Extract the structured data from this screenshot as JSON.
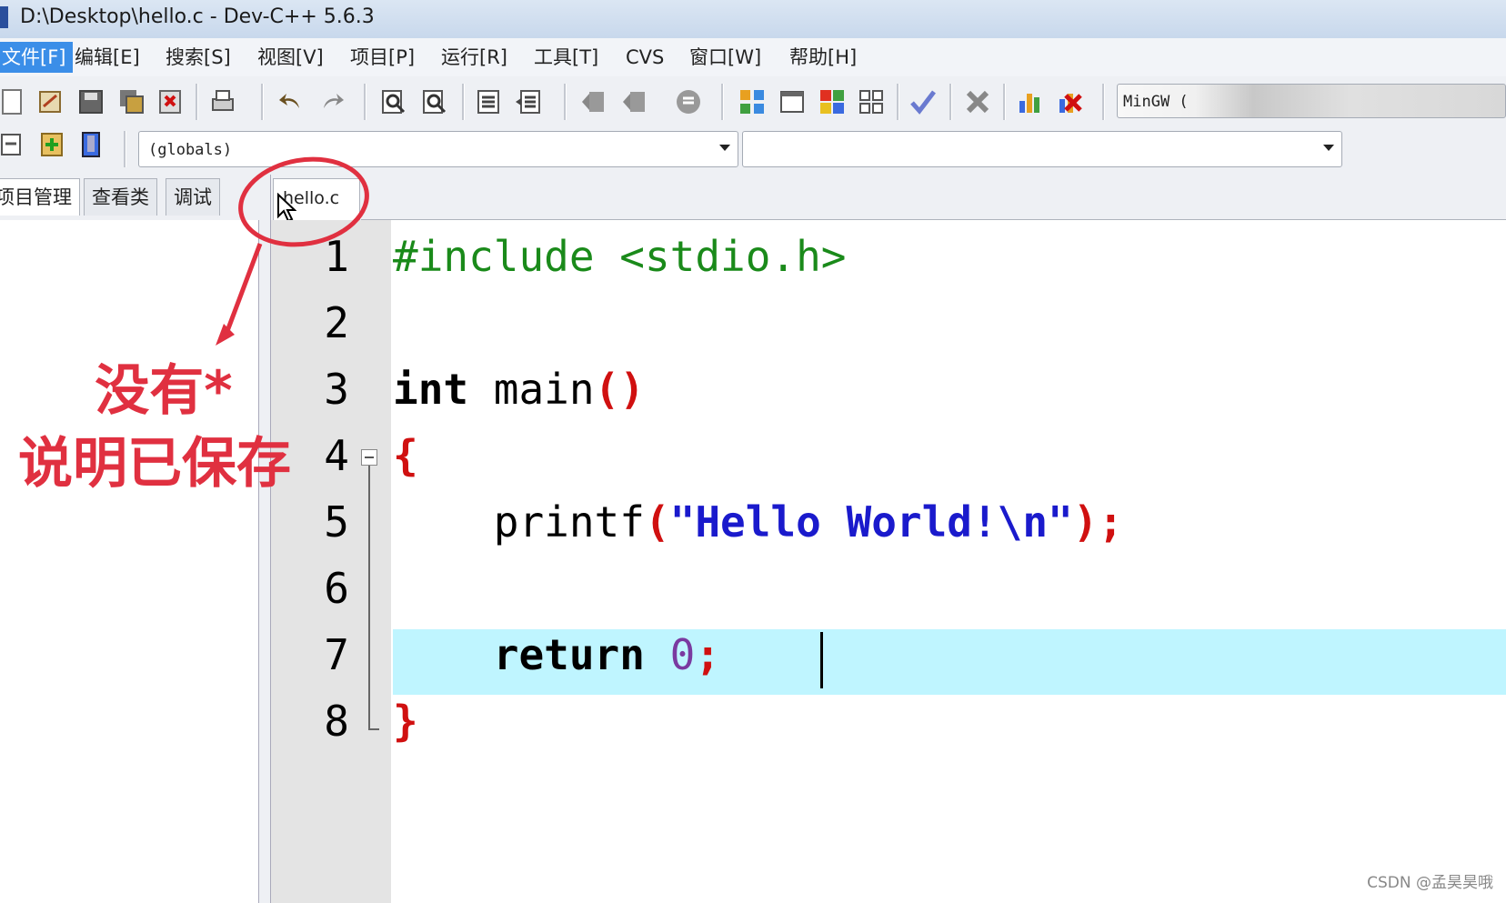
{
  "window": {
    "title": "D:\\Desktop\\hello.c - Dev-C++ 5.6.3"
  },
  "menu": {
    "items": [
      "文件[F]",
      "编辑[E]",
      "搜索[S]",
      "视图[V]",
      "项目[P]",
      "运行[R]",
      "工具[T]",
      "CVS",
      "窗口[W]",
      "帮助[H]"
    ],
    "active_index": 0
  },
  "toolbar": {
    "compiler": "MinGW ("
  },
  "scope": {
    "globals": "(globals)",
    "function": ""
  },
  "panel_tabs": [
    "项目管理",
    "查看类",
    "调试"
  ],
  "editor": {
    "file_tab": "hello.c",
    "line_numbers": [
      "1",
      "2",
      "3",
      "4",
      "5",
      "6",
      "7",
      "8"
    ],
    "code": {
      "l1": "#include <stdio.h>",
      "l3_kw": "int",
      "l3_rest": " main",
      "l3_paren": "()",
      "l4": "{",
      "l5_fn": "    printf",
      "l5_open": "(",
      "l5_str": "\"Hello World!\\n\"",
      "l5_close": ");",
      "l7_kw": "    return",
      "l7_sp": " ",
      "l7_num": "0",
      "l7_semi": ";",
      "l8": "}"
    },
    "current_line": 7
  },
  "annotation": {
    "line1": "没有*",
    "line2": "说明已保存",
    "color": "#e03040"
  },
  "watermark": "CSDN @孟昊昊哦"
}
